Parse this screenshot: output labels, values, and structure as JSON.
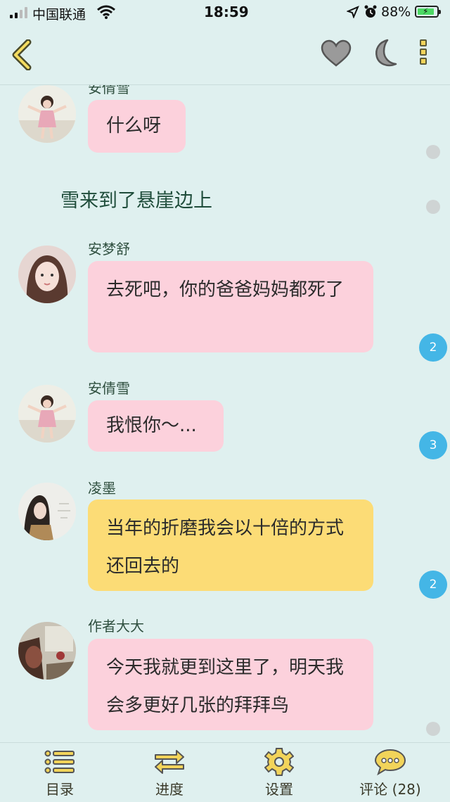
{
  "status_bar": {
    "carrier": "中国联通",
    "time": "18:59",
    "battery": "88%"
  },
  "header": {
    "icons": [
      "back-icon",
      "heart-icon",
      "moon-icon",
      "more-icon"
    ]
  },
  "messages": [
    {
      "type": "chat",
      "speaker": "安倩雪",
      "text": "什么呀",
      "color": "pink"
    },
    {
      "type": "narration",
      "text": "雪来到了悬崖边上"
    },
    {
      "type": "chat",
      "speaker": "安梦舒",
      "text": "去死吧，你的爸爸妈妈都死了",
      "color": "pink",
      "comments": "2"
    },
    {
      "type": "chat",
      "speaker": "安倩雪",
      "text": "我恨你～...",
      "color": "pink",
      "comments": "3"
    },
    {
      "type": "chat",
      "speaker": "凌墨",
      "text": "当年的折磨我会以十倍的方式还回去的",
      "color": "yellow",
      "comments": "2"
    },
    {
      "type": "chat",
      "speaker": "作者大大",
      "text": "今天我就更到这里了，明天我会多更好几张的拜拜鸟",
      "color": "pink"
    }
  ],
  "bottom_nav": {
    "catalog": "目录",
    "progress": "进度",
    "settings": "设置",
    "comments": "评论 (28)"
  },
  "colors": {
    "background": "#dff0ef",
    "pink_bubble": "#fcd1dc",
    "yellow_bubble": "#fcdc76",
    "badge": "#44b6e6"
  }
}
